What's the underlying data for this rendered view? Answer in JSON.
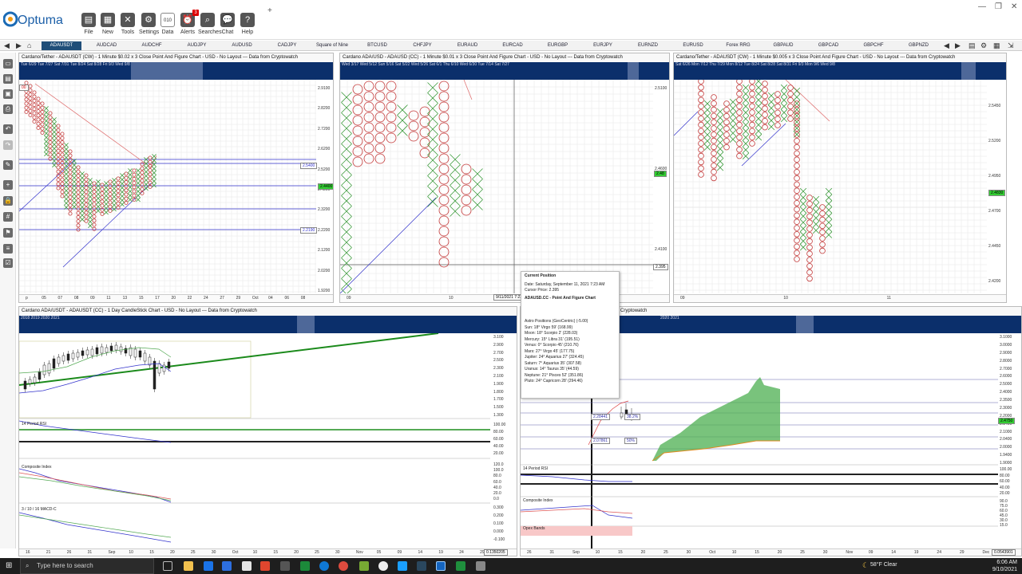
{
  "app": {
    "brand": "Optuma"
  },
  "ribbon": {
    "file": "File",
    "new": "New",
    "tools": "Tools",
    "settings": "Settings",
    "data": "Data",
    "alerts": "Alerts",
    "alerts_badge": "3",
    "searches": "Searches",
    "chat": "Chat",
    "help": "Help"
  },
  "tabs": [
    "ADAUSDT",
    "AUDCAD",
    "AUDCHF",
    "AUDJPY",
    "AUDUSD",
    "CADJPY",
    "Square of Nine",
    "BTCUSD",
    "CHFJPY",
    "EURAUD",
    "EURCAD",
    "EURGBP",
    "EURJPY",
    "EURNZD",
    "EURUSD",
    "Forex RRG",
    "GBPAUD",
    "GBPCAD",
    "GBPCHF",
    "GBPNZD"
  ],
  "panels": {
    "p1": {
      "title": "Cardano/Tether - ADAUSDT (CW) - 1 Minute $0.02 x 3 Close Point And Figure Chart - USD - No Layout --- Data from Cryptowatch",
      "ov_dates": "Tue 6/29   Tue 7/27   Sat 7/31   Tue 8/24   Sat 8/28   Fri 9/3   Wed 9/8",
      "yticks": [
        "2.9100",
        "2.8200",
        "2.7200",
        "2.6200",
        "2.5200",
        "2.4200",
        "2.3200",
        "2.2200",
        "2.1200",
        "2.0200",
        "1.9200"
      ],
      "labels": {
        "hl1": "2.5400",
        "hl2": "2.4400",
        "hl3": "2.2190",
        "box": "00"
      },
      "xticks": [
        "p",
        "05",
        "07",
        "08",
        "09",
        "11",
        "13",
        "15",
        "17",
        "20",
        "22",
        "24",
        "27",
        "29",
        "Oct",
        "04",
        "06",
        "08"
      ]
    },
    "p2": {
      "title": "Cardano ADA/USD - ADAUSD (CC) - 1 Minute $0.01 x 3 Close Point And Figure Chart - USD - No Layout --- Data from Cryptowatch",
      "ov_dates": "Wed 3/17   Wed 5/12   Sun 5/16   Sat 5/22   Wed 5/26   Sat 6/1   Thu 6/10   Wed 6/30   Tue 7/14   Sat 7/27",
      "yticks": [
        "2.5100",
        "2.4600",
        "2.4100"
      ],
      "labels": {
        "cursor": "2.395",
        "price": "2.48",
        "date": "9/11/2021 7:23"
      },
      "xticks": [
        "09",
        "10",
        "14"
      ]
    },
    "p3": {
      "title": "Cardano/Tether - ADAUSDT (CW) - 1 Minute $0.005 x 3 Close Point And Figure Chart - USD - No Layout --- Data from Cryptowatch",
      "ov_dates": "Sat 6/26   Mon 7/12   Thu 7/29   Mon 8/12   Tue 8/24   Sat 8/28   Sat 8/31   Fri 9/3   Mon 9/6   Wed 9/8",
      "yticks": [
        "2.5450",
        "2.5200",
        "2.4950",
        "2.4700",
        "2.4450",
        "2.4200"
      ],
      "labels": {
        "price": "2.4830"
      },
      "xticks": [
        "09",
        "10",
        "11"
      ]
    },
    "p4": {
      "title": "Cardano ADA/USDT - ADAUSDT (CC) - 1 Day CandleStick Chart - USD - No Layout --- Data from Cryptowatch",
      "ov_dates": "2018            2019            2020            2021",
      "yticks": [
        "3.100",
        "2.900",
        "2.700",
        "2.500",
        "2.300",
        "2.100",
        "1.900",
        "1.800",
        "1.700",
        "1.500",
        "1.300"
      ],
      "rsi": "14 Period RSI",
      "rsi_ticks": [
        "100.00",
        "80.00",
        "60.00",
        "40.00",
        "20.00"
      ],
      "comp": "Composite Index",
      "comp_ticks": [
        "120.0",
        "100.0",
        "80.0",
        "60.0",
        "40.0",
        "20.0",
        "0.0"
      ],
      "macd": "3 / 10 / 16 MACD-C",
      "macd_ticks": [
        "0.300",
        "0.200",
        "0.100",
        "0.000",
        "-0.100"
      ],
      "xticks": [
        "16",
        "21",
        "26",
        "31",
        "Sep",
        "10",
        "15",
        "20",
        "25",
        "30",
        "Oct",
        "10",
        "15",
        "20",
        "25",
        "30",
        "Nov",
        "05",
        "09",
        "14",
        "19",
        "24",
        "29"
      ],
      "cursor_price": "0.1350205"
    },
    "p5": {
      "title": "leStick Chart - USD - No Layout --- Data from Cryptowatch",
      "ov_dates": "2020            2021",
      "yticks": [
        "3.1000",
        "3.0000",
        "2.9000",
        "2.8000",
        "2.7000",
        "2.6000",
        "2.5000",
        "2.4000",
        "2.3500",
        "2.3000",
        "2.2000",
        "2.1400",
        "2.1000",
        "2.0400",
        "2.0000",
        "1.9400",
        "1.9000"
      ],
      "price": "2.4750",
      "fib1": "2.28441",
      "fib1p": "38.2%",
      "fib2": "2.07861",
      "fib2p": "50%",
      "rsi": "14 Period RSI",
      "rsi_ticks": [
        "100.00",
        "80.00",
        "60.00",
        "40.00",
        "20.00"
      ],
      "comp": "Composite Index",
      "comp_ticks": [
        "90.0",
        "75.0",
        "60.0",
        "45.0",
        "30.0",
        "15.0"
      ],
      "opex": "Opex Bands",
      "xticks": [
        "26",
        "31",
        "Sep",
        "10",
        "15",
        "20",
        "25",
        "30",
        "Oct",
        "10",
        "15",
        "20",
        "25",
        "30",
        "Nov",
        "09",
        "14",
        "19",
        "24",
        "29",
        "Dec"
      ],
      "cursor_price": "0.0543901"
    }
  },
  "tooltip": {
    "head": "Current Position",
    "date": "Date: Saturday, September 11, 2021 7:23 AM",
    "cursor": "Cursor Price: 2.395",
    "chart": "ADAUSD.CC - Point And Figure Chart",
    "astro": "Astro Positions (GeoCentric) (-5.00)",
    "lines": [
      "Sun: 18° Virgo 59' (168.99)",
      "Moon: 18° Scorpio 2' (228.03)",
      "Mercury: 15° Libra 31' (195.51)",
      "Venus: 0° Scorpio 45' (210.76)",
      "Mars: 27° Virgo 45' (177.75)",
      "Jupiter: 24° Aquarius 27' (324.45)",
      "Saturn: 7° Aquarius 35' (307.58)",
      "Uranus: 14° Taurus 35' (44.59)",
      "Neptune: 21° Pisces 52' (351.86)",
      "Pluto: 24° Capricorn 28' (294.46)"
    ]
  },
  "taskbar": {
    "search": "Type here to search",
    "weather": "58°F  Clear",
    "time": "6:06 AM",
    "date": "9/10/2021"
  }
}
